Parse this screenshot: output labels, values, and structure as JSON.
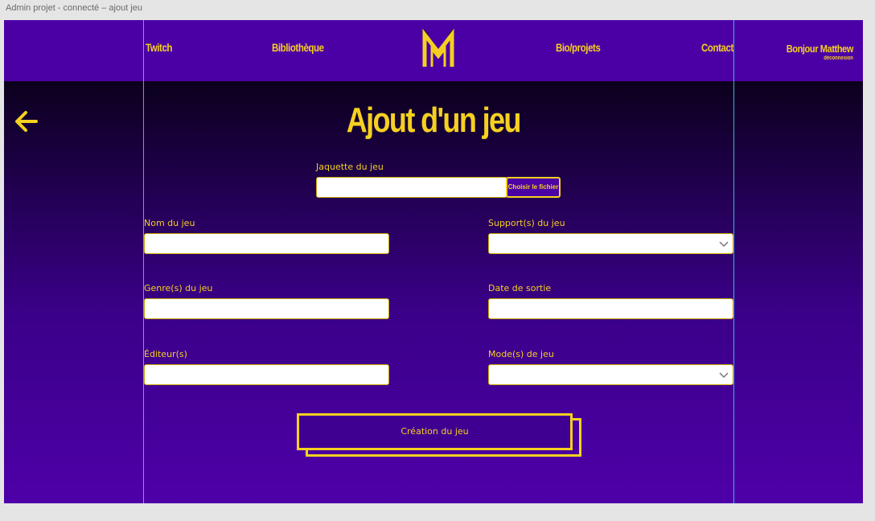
{
  "frame": {
    "title": "Admin projet - connecté – ajout jeu"
  },
  "nav": {
    "twitch": "Twitch",
    "library": "Bibliothèque",
    "bio": "Bio/projets",
    "contact": "Contact",
    "greeting": "Bonjour Matthew",
    "logout": "déconnexion"
  },
  "page": {
    "title": "Ajout d'un jeu"
  },
  "form": {
    "cover_label": "Jaquette du jeu",
    "file_button": "Choisir le fichier",
    "name_label": "Nom du jeu",
    "support_label": "Support(s) du jeu",
    "genre_label": "Genre(s) du jeu",
    "release_label": "Date de sortie",
    "publisher_label": "Éditeur(s)",
    "mode_label": "Mode(s) de jeu",
    "submit": "Création du jeu"
  },
  "colors": {
    "accent": "#f5d020",
    "navbar": "#4b00a6",
    "guide": "#3bd4ff"
  },
  "icons": {
    "back": "arrow-left-icon",
    "logo": "m-logo-icon",
    "dropdown": "chevron-down-icon"
  }
}
